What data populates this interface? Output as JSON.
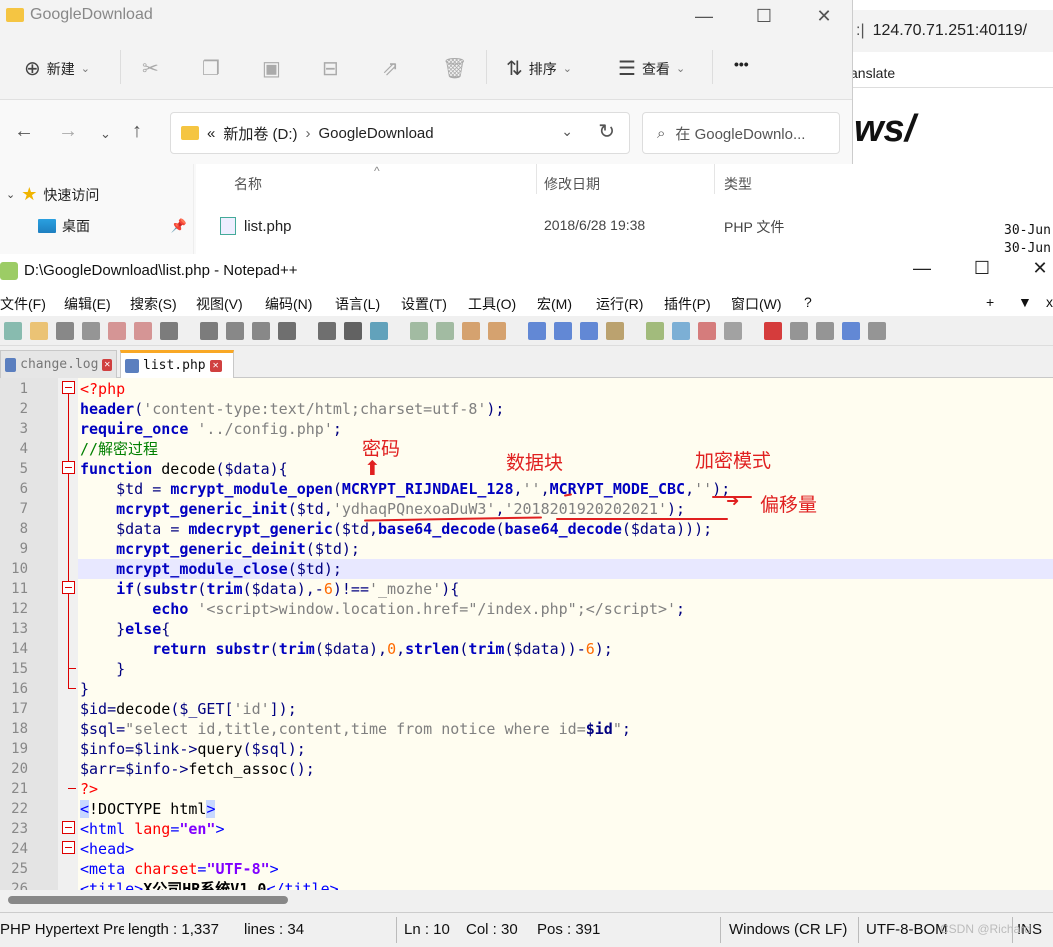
{
  "browser": {
    "address": "124.70.71.251:40119/",
    "translate": "anslate",
    "heading_fragment": "ws/",
    "dates": [
      "30-Jun",
      "30-Jun"
    ]
  },
  "explorer": {
    "title": "GoogleDownload",
    "commands": {
      "new": "新建",
      "sort": "排序",
      "view": "查看",
      "more": "•••"
    },
    "path": {
      "root": "新加卷 (D:)",
      "folder": "GoogleDownload",
      "prefix": "«"
    },
    "search_placeholder": "在 GoogleDownlo...",
    "sidebar": [
      {
        "label": "快速访问"
      },
      {
        "label": "桌面"
      }
    ],
    "columns": {
      "name": "名称",
      "modified": "修改日期",
      "type": "类型"
    },
    "files": [
      {
        "name": "list.php",
        "modified": "2018/6/28 19:38",
        "type": "PHP 文件"
      }
    ]
  },
  "npp": {
    "title": "D:\\GoogleDownload\\list.php - Notepad++",
    "menu": [
      "文件(F)",
      "编辑(E)",
      "搜索(S)",
      "视图(V)",
      "编码(N)",
      "语言(L)",
      "设置(T)",
      "工具(O)",
      "宏(M)",
      "运行(R)",
      "插件(P)",
      "窗口(W)",
      "?"
    ],
    "menu_right": [
      "+",
      "▼",
      "x"
    ],
    "tabs": [
      {
        "label": "change.log",
        "active": false
      },
      {
        "label": "list.php",
        "active": true
      }
    ],
    "lines": [
      {
        "n": "1"
      },
      {
        "n": "2"
      },
      {
        "n": "3"
      },
      {
        "n": "4"
      },
      {
        "n": "5"
      },
      {
        "n": "6"
      },
      {
        "n": "7"
      },
      {
        "n": "8"
      },
      {
        "n": "9"
      },
      {
        "n": "10"
      },
      {
        "n": "11"
      },
      {
        "n": "12"
      },
      {
        "n": "13"
      },
      {
        "n": "14"
      },
      {
        "n": "15"
      },
      {
        "n": "16"
      },
      {
        "n": "17"
      },
      {
        "n": "18"
      },
      {
        "n": "19"
      },
      {
        "n": "20"
      },
      {
        "n": "21"
      },
      {
        "n": "22"
      },
      {
        "n": "23"
      },
      {
        "n": "24"
      },
      {
        "n": "25"
      },
      {
        "n": "26"
      }
    ],
    "annotations": {
      "key": "密码",
      "block": "数据块",
      "mode": "加密模式",
      "iv": "偏移量"
    },
    "status": {
      "lang": "PHP Hypertext Pre",
      "length": "length : 1,337",
      "lines": "lines : 34",
      "ln": "Ln : 10",
      "col": "Col : 30",
      "pos": "Pos : 391",
      "eol": "Windows (CR LF)",
      "enc": "UTF-8-BOM",
      "ins": "INS",
      "watermark": "CSDN @Richard"
    }
  }
}
